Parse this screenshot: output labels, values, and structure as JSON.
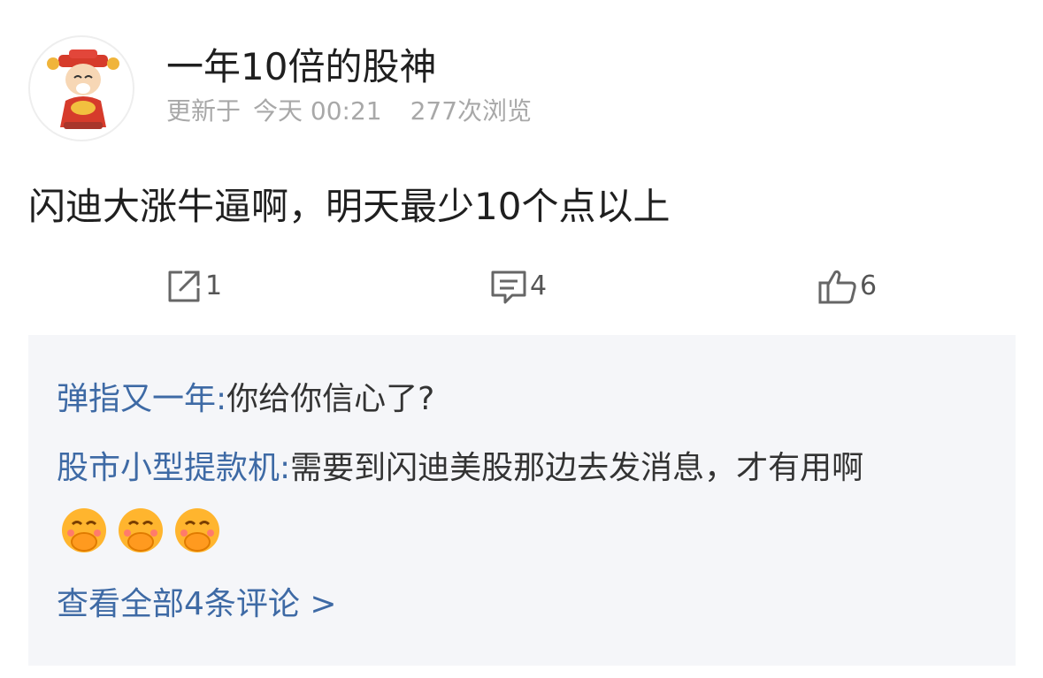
{
  "post": {
    "author": "一年10倍的股神",
    "updated_label": "更新于",
    "updated_time": "今天 00:21",
    "views": "277次浏览",
    "text": "闪迪大涨牛逼啊，明天最少10个点以上",
    "share_count": "1",
    "comment_count": "4",
    "like_count": "6"
  },
  "comments": [
    {
      "author": "弹指又一年:",
      "text": "你给你信心了?"
    },
    {
      "author": "股市小型提款机:",
      "text": "需要到闪迪美股那边去发消息，才有用啊",
      "emojis": [
        "covering-mouth-emoji",
        "covering-mouth-emoji",
        "covering-mouth-emoji"
      ]
    }
  ],
  "view_all_label": "查看全部4条评论 >",
  "icons": [
    "share-icon",
    "comment-icon",
    "like-icon"
  ],
  "colors": {
    "link": "#3e6aa5",
    "meta": "#a8a8a8",
    "panel": "#f5f6f9"
  }
}
